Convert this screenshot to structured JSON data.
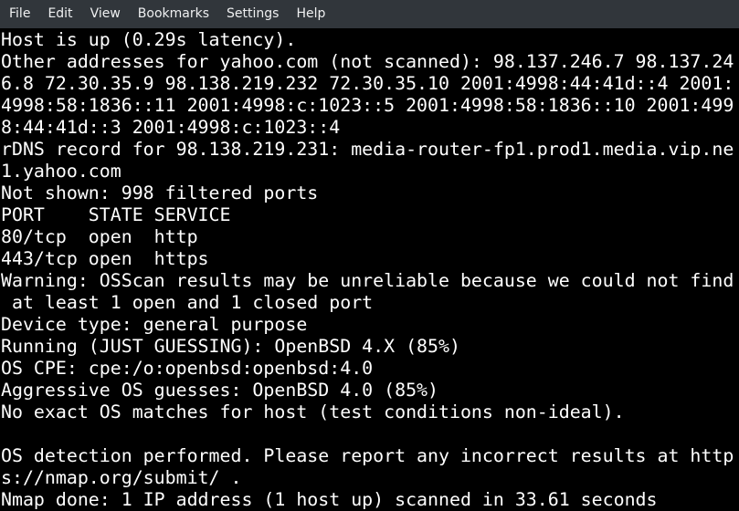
{
  "menubar": {
    "items": [
      {
        "label": "File"
      },
      {
        "label": "Edit"
      },
      {
        "label": "View"
      },
      {
        "label": "Bookmarks"
      },
      {
        "label": "Settings"
      },
      {
        "label": "Help"
      }
    ]
  },
  "terminal": {
    "lines": [
      "Host is up (0.29s latency).",
      "Other addresses for yahoo.com (not scanned): 98.137.246.7 98.137.24",
      "6.8 72.30.35.9 98.138.219.232 72.30.35.10 2001:4998:44:41d::4 2001:",
      "4998:58:1836::11 2001:4998:c:1023::5 2001:4998:58:1836::10 2001:499",
      "8:44:41d::3 2001:4998:c:1023::4",
      "rDNS record for 98.138.219.231: media-router-fp1.prod1.media.vip.ne",
      "1.yahoo.com",
      "Not shown: 998 filtered ports",
      "PORT    STATE SERVICE",
      "80/tcp  open  http",
      "443/tcp open  https",
      "Warning: OSScan results may be unreliable because we could not find",
      " at least 1 open and 1 closed port",
      "Device type: general purpose",
      "Running (JUST GUESSING): OpenBSD 4.X (85%)",
      "OS CPE: cpe:/o:openbsd:openbsd:4.0",
      "Aggressive OS guesses: OpenBSD 4.0 (85%)",
      "No exact OS matches for host (test conditions non-ideal).",
      "",
      "OS detection performed. Please report any incorrect results at http",
      "s://nmap.org/submit/ .",
      "Nmap done: 1 IP address (1 host up) scanned in 33.61 seconds"
    ]
  }
}
